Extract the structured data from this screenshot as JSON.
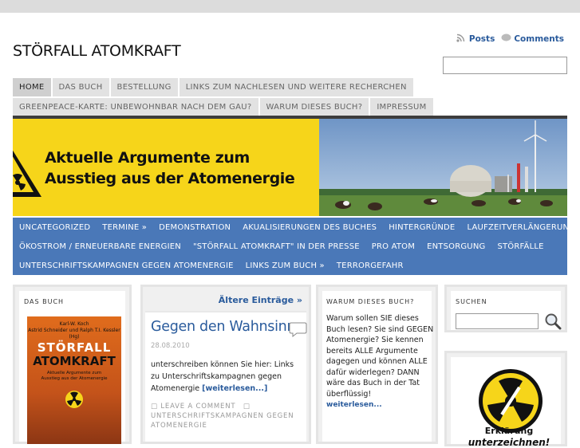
{
  "site": {
    "title": "STÖRFALL ATOMKRAFT",
    "feeds": {
      "posts": "Posts",
      "comments": "Comments"
    },
    "search_top": {
      "value": ""
    }
  },
  "nav_primary": {
    "row1": [
      "HOME",
      "DAS BUCH",
      "BESTELLUNG",
      "LINKS ZUM NACHLESEN UND WEITERE RECHERCHEN"
    ],
    "row2": [
      "GREENPEACE-KARTE: UNBEWOHNBAR NACH DEM GAU?",
      "WARUM DIESES BUCH?",
      "IMPRESSUM"
    ],
    "active": "HOME"
  },
  "banner": {
    "line1": "Aktuelle Argumente zum",
    "line2": "Ausstieg aus der Atomenergie",
    "colors": {
      "yellow": "#f6d51a"
    }
  },
  "nav_categories": {
    "row1": [
      "UNCATEGORIZED",
      "TERMINE »",
      "DEMONSTRATION",
      "AKUALISIERUNGEN DES BUCHES",
      "HINTERGRÜNDE",
      "LAUFZEITVERLÄNGERUNG"
    ],
    "row2": [
      "ÖKOSTROM / ERNEUERBARE ENERGIEN",
      "\"STÖRFALL ATOMKRAFT\" IN DER PRESSE",
      "PRO ATOM",
      "ENTSORGUNG",
      "STÖRFÄLLE"
    ],
    "row3": [
      "UNTERSCHRIFTSKAMPAGNEN GEGEN ATOMENERGIE",
      "LINKS ZUM BUCH »",
      "TERRORGEFAHR"
    ],
    "colors": {
      "bar": "#4a78b8"
    }
  },
  "widgets": {
    "book": {
      "title": "DAS BUCH",
      "cover_authors": "Karl-W. Koch\nAstrid Schneider und Ralph T.I. Kessler (Hg)",
      "cover_title1": "STÖRFALL",
      "cover_title2": "ATOMKRAFT",
      "cover_sub": "Aktuelle Argumente zum\nAusstieg aus der Atomenergie"
    },
    "post": {
      "older_link": "Ältere Einträge »",
      "title": "Gegen den Wahnsinn",
      "date": "28.08.2010",
      "body": "unterschreiben können Sie hier: Links zu Unterschriftskampagnen gegen Atomenergie ",
      "more": "[weiterlesen...]",
      "comment": "LEAVE A COMMENT",
      "category": "UNTERSCHRIFTSKAMPAGNEN GEGEN ATOMENERGIE"
    },
    "why": {
      "title": "WARUM DIESES BUCH?",
      "body": "Warum sollen SIE dieses Buch lesen? Sie sind GEGEN Atomenergie? Sie kennen bereits ALLE Argumente dagegen und können ALLE dafür widerlegen? DANN wäre das Buch in der Tat überflüssig!",
      "more": "weiterlesen..."
    },
    "search": {
      "title": "SUCHEN",
      "value": ""
    },
    "badge": {
      "text1": "Erklärung",
      "text2": "unterzeichnen!"
    }
  }
}
